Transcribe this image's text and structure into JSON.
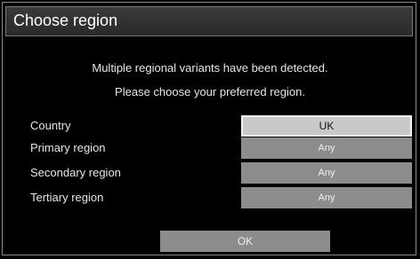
{
  "dialog": {
    "title": "Choose region",
    "message_line1": "Multiple regional variants have been detected.",
    "message_line2": "Please choose your preferred region."
  },
  "rows": [
    {
      "label": "Country",
      "value": "UK"
    },
    {
      "label": "Primary region",
      "value": "Any"
    },
    {
      "label": "Secondary region",
      "value": "Any"
    },
    {
      "label": "Tertiary region",
      "value": "Any"
    }
  ],
  "ok_label": "OK",
  "colors": {
    "background": "#000000",
    "selector": "#8c8c8c",
    "selector_focused": "#c9c9c9"
  }
}
